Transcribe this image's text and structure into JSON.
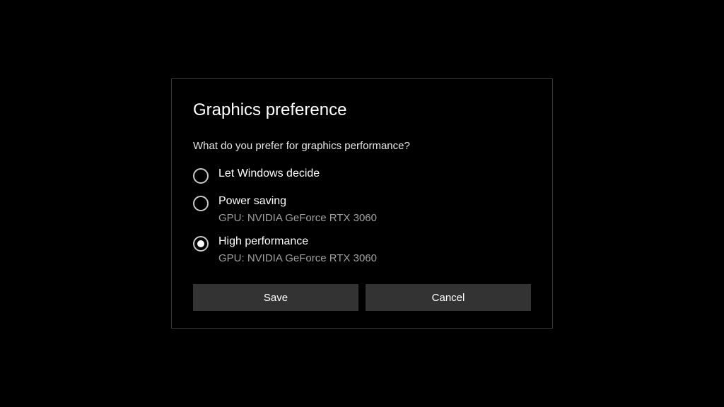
{
  "dialog": {
    "title": "Graphics preference",
    "subtitle": "What do you prefer for graphics performance?",
    "options": [
      {
        "label": "Let Windows decide",
        "detail": null,
        "selected": false
      },
      {
        "label": "Power saving",
        "detail": "GPU: NVIDIA GeForce RTX 3060",
        "selected": false
      },
      {
        "label": "High performance",
        "detail": "GPU: NVIDIA GeForce RTX 3060",
        "selected": true
      }
    ],
    "buttons": {
      "save": "Save",
      "cancel": "Cancel"
    }
  }
}
